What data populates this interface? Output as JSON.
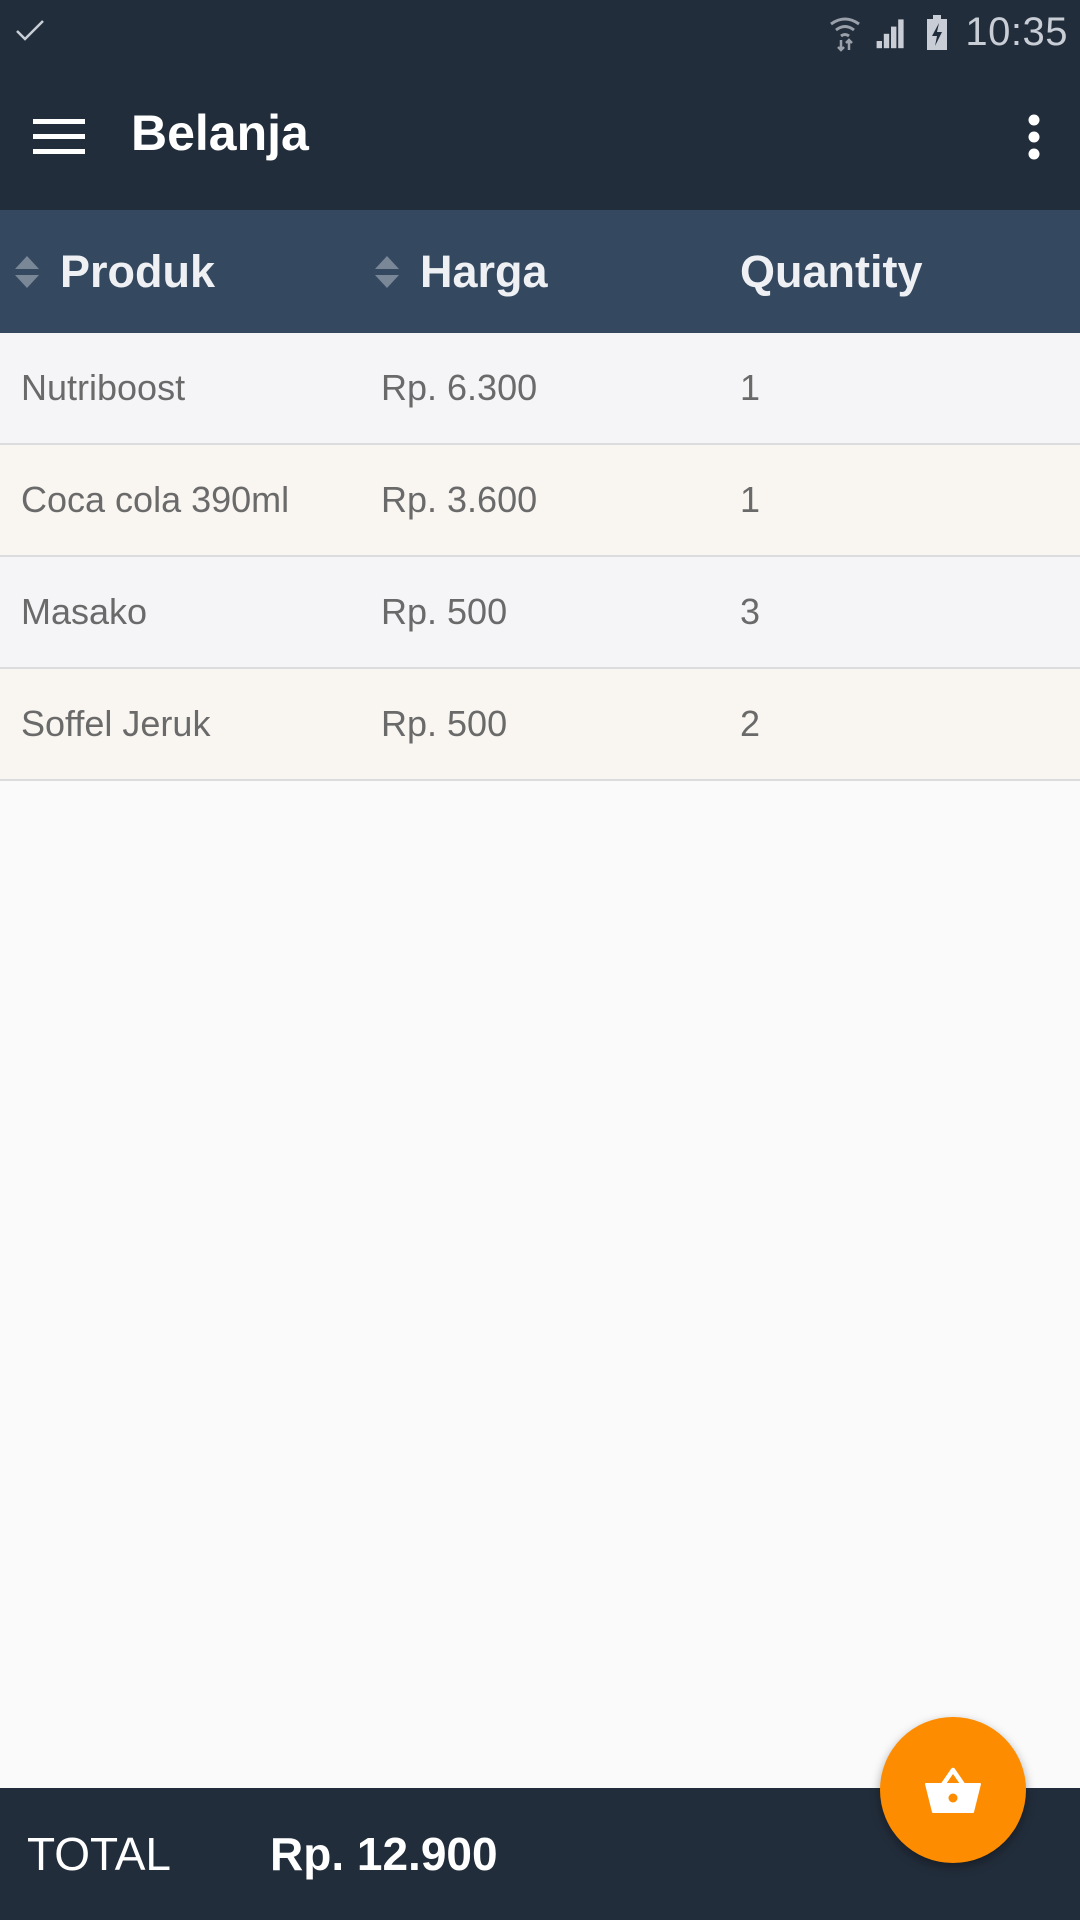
{
  "status_bar": {
    "time": "10:35",
    "icons": [
      "check-icon",
      "wifi-icon",
      "signal-icon",
      "battery-charging-icon"
    ]
  },
  "app_bar": {
    "title": "Belanja",
    "menu_icon": "hamburger-menu-icon",
    "overflow_icon": "more-vert-icon"
  },
  "table": {
    "headers": {
      "produk": "Produk",
      "harga": "Harga",
      "quantity": "Quantity"
    },
    "rows": [
      {
        "produk": "Nutriboost",
        "harga": "Rp. 6.300",
        "quantity": "1"
      },
      {
        "produk": "Coca cola 390ml",
        "harga": "Rp. 3.600",
        "quantity": "1"
      },
      {
        "produk": "Masako",
        "harga": "Rp. 500",
        "quantity": "3"
      },
      {
        "produk": "Soffel Jeruk",
        "harga": "Rp. 500",
        "quantity": "2"
      }
    ]
  },
  "footer": {
    "total_label": "TOTAL",
    "total_value": "Rp. 12.900"
  },
  "fab": {
    "icon": "basket-icon"
  },
  "colors": {
    "app_bar": "#222d3b",
    "table_header": "#34485f",
    "accent": "#fd8c00",
    "row_odd": "#f5f5f8",
    "row_even": "#f9f6f2"
  }
}
